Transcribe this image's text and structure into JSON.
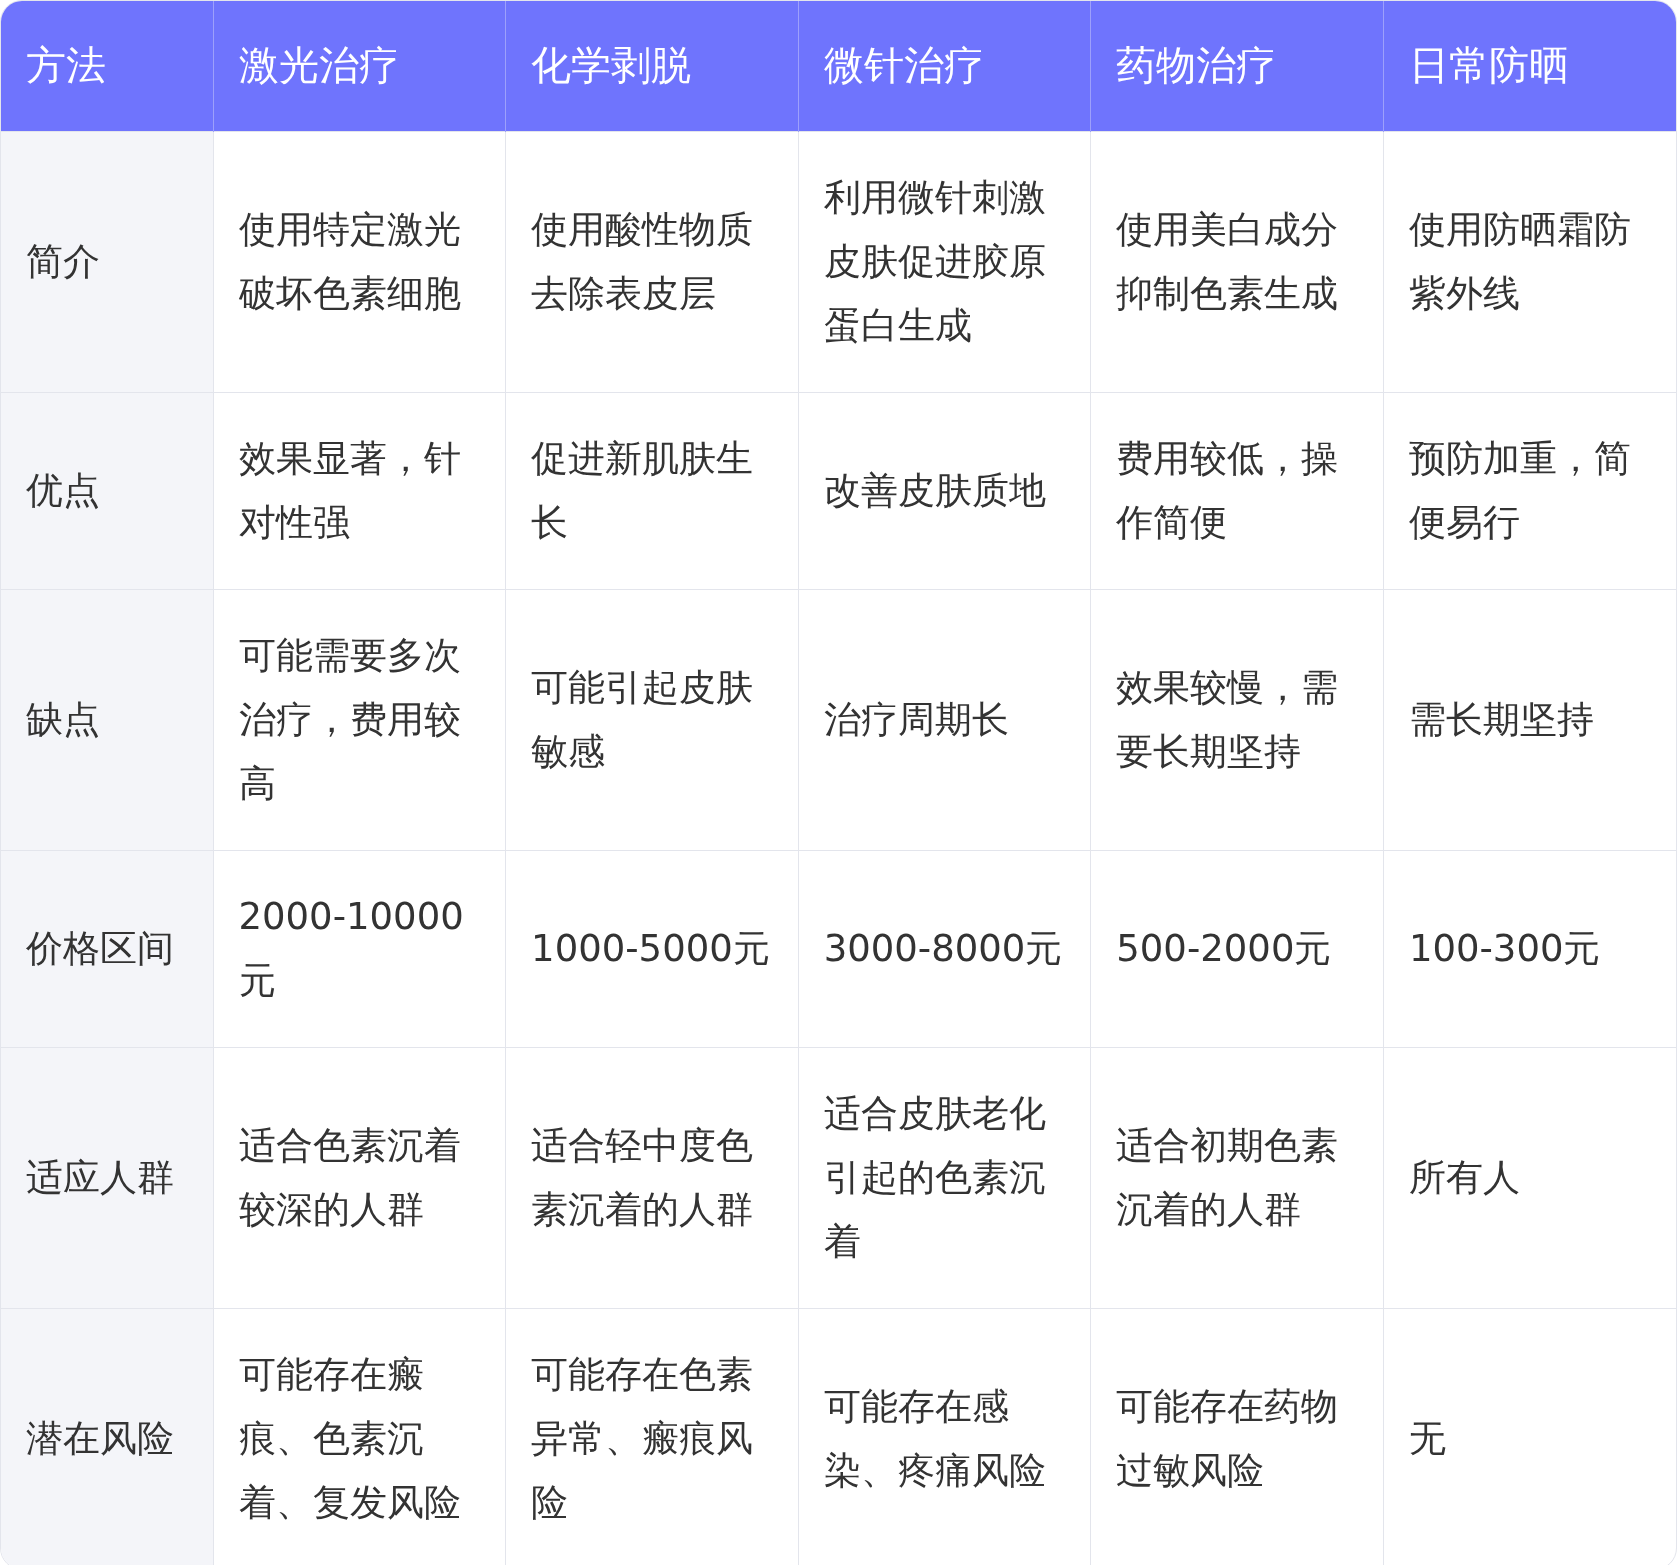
{
  "table": {
    "columns": [
      "方法",
      "激光治疗",
      "化学剥脱",
      "微针治疗",
      "药物治疗",
      "日常防晒"
    ],
    "rows": [
      {
        "cells": [
          "简介",
          "使用特定激光破坏色素细胞",
          "使用酸性物质去除表皮层",
          "利用微针刺激皮肤促进胶原蛋白生成",
          "使用美白成分抑制色素生成",
          "使用防晒霜防紫外线"
        ]
      },
      {
        "cells": [
          "优点",
          "效果显著，针对性强",
          "促进新肌肤生长",
          "改善皮肤质地",
          "费用较低，操作简便",
          "预防加重，简便易行"
        ]
      },
      {
        "cells": [
          "缺点",
          "可能需要多次治疗，费用较高",
          "可能引起皮肤敏感",
          "治疗周期长",
          "效果较慢，需要长期坚持",
          "需长期坚持"
        ]
      },
      {
        "cells": [
          "价格区间",
          "2000-10000元",
          "1000-5000元",
          "3000-8000元",
          "500-2000元",
          "100-300元"
        ]
      },
      {
        "cells": [
          "适应人群",
          "适合色素沉着较深的人群",
          "适合轻中度色素沉着的人群",
          "适合皮肤老化引起的色素沉着",
          "适合初期色素沉着的人群",
          "所有人"
        ]
      },
      {
        "cells": [
          "潜在风险",
          "可能存在瘢痕、色素沉着、复发风险",
          "可能存在色素异常、瘢痕风险",
          "可能存在感染、疼痛风险",
          "可能存在药物过敏风险",
          "无"
        ]
      }
    ]
  }
}
